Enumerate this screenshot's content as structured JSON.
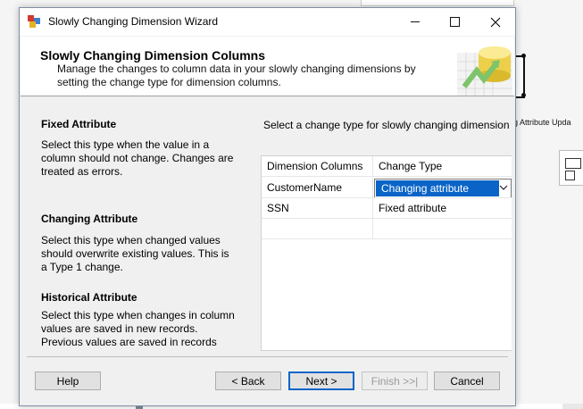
{
  "dialog": {
    "title": "Slowly Changing Dimension Wizard"
  },
  "header": {
    "title": "Slowly Changing Dimension Columns",
    "description": "Manage the changes to column data in your slowly changing dimensions by setting the change type for dimension columns."
  },
  "left": {
    "fixed": {
      "heading": "Fixed Attribute",
      "text": "Select this type when the value in a column should not change. Changes are treated as errors."
    },
    "changing": {
      "heading": "Changing Attribute",
      "text": "Select this type when changed values should overwrite existing values. This is a Type 1 change."
    },
    "historical": {
      "heading": "Historical Attribute",
      "text": "Select this type when changes in column values are saved in new records. Previous values are saved in records marked as"
    }
  },
  "right": {
    "prompt": "Select a change type for slowly changing dimension",
    "columns": [
      "Dimension Columns",
      "Change Type"
    ],
    "rows": [
      {
        "column": "CustomerName",
        "type": "Changing attribute"
      },
      {
        "column": "SSN",
        "type": "Fixed attribute"
      }
    ]
  },
  "buttons": {
    "help": "Help",
    "back": "< Back",
    "next": "Next >",
    "finish": "Finish >>|",
    "cancel": "Cancel"
  },
  "background": {
    "label": "g Attribute Upda"
  },
  "colors": {
    "selection": "#0a64c8",
    "accent_border": "#0a64c8"
  }
}
